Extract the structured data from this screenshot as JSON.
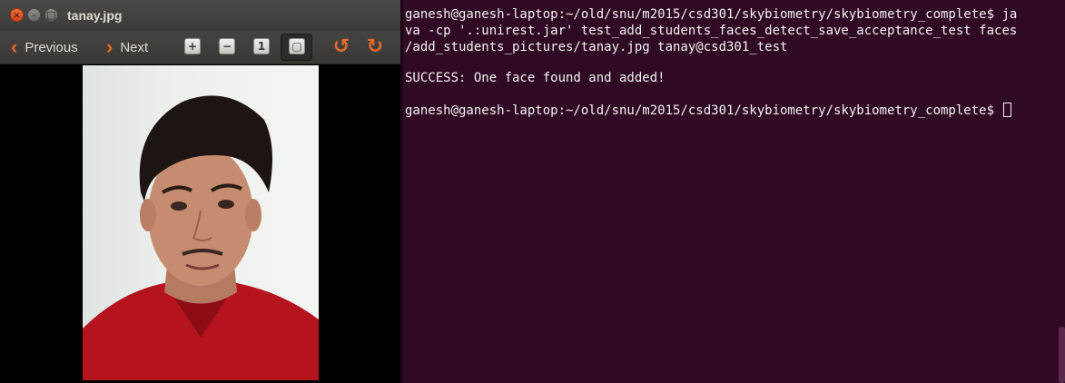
{
  "viewer": {
    "title": "tanay.jpg",
    "toolbar": {
      "previous_label": "Previous",
      "next_label": "Next",
      "zoom_in_icon": "zoom-in-icon",
      "zoom_out_icon": "zoom-out-icon",
      "normal_size_icon": "normal-size-icon",
      "best_fit_icon": "best-fit-icon",
      "rotate_left_icon": "rotate-left-icon",
      "rotate_right_icon": "rotate-right-icon"
    }
  },
  "terminal": {
    "lines": [
      "ganesh@ganesh-laptop:~/old/snu/m2015/csd301/skybiometry/skybiometry_complete$ ja",
      "va -cp '.:unirest.jar' test_add_students_faces_detect_save_acceptance_test faces",
      "/add_students_pictures/tanay.jpg tanay@csd301_test",
      "",
      "SUCCESS: One face found and added!",
      "",
      "ganesh@ganesh-laptop:~/old/snu/m2015/csd301/skybiometry/skybiometry_complete$ "
    ]
  },
  "colors": {
    "terminal_bg": "#300a24",
    "accent_orange": "#e36a2a",
    "titlebar": "#3c3b37"
  }
}
